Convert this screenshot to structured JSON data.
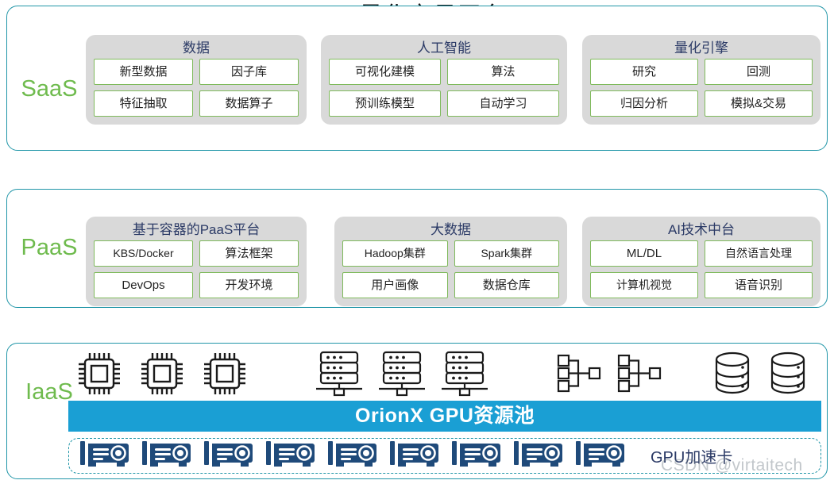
{
  "title": "AI 量化交易平台",
  "layers": [
    {
      "id": "saas",
      "label": "SaaS",
      "groups": [
        {
          "title": "数据",
          "cells": [
            "新型数据",
            "因子库",
            "特征抽取",
            "数据算子"
          ]
        },
        {
          "title": "人工智能",
          "cells": [
            "可视化建模",
            "算法",
            "预训练模型",
            "自动学习"
          ]
        },
        {
          "title": "量化引擎",
          "cells": [
            "研究",
            "回测",
            "归因分析",
            "模拟&交易"
          ]
        }
      ]
    },
    {
      "id": "paas",
      "label": "PaaS",
      "groups": [
        {
          "title": "基于容器的PaaS平台",
          "cells": [
            "KBS/Docker",
            "算法框架",
            "DevOps",
            "开发环境"
          ]
        },
        {
          "title": "大数据",
          "cells": [
            "Hadoop集群",
            "Spark集群",
            "用户画像",
            "数据仓库"
          ]
        },
        {
          "title": "AI技术中台",
          "cells": [
            "ML/DL",
            "自然语言处理",
            "计算机视觉",
            "语音识别"
          ]
        }
      ]
    },
    {
      "id": "iaas",
      "label": "IaaS",
      "icons": [
        {
          "name": "cpu-chip-icon",
          "count": 3
        },
        {
          "name": "server-rack-icon",
          "count": 3
        },
        {
          "name": "network-topology-icon",
          "count": 2
        },
        {
          "name": "database-cylinder-icon",
          "count": 2
        }
      ],
      "resource_pool_bar": "OrionX GPU资源池",
      "gpu_strip": {
        "card_icon": "gpu-accelerator-card-icon",
        "card_count": 9,
        "label": "GPU加速卡"
      }
    }
  ],
  "watermark": "CSDN @virtaitech",
  "colors": {
    "panel_border": "#2196a8",
    "layer_label": "#6fbb4e",
    "group_bg": "#d9d9d9",
    "group_title": "#2b3a66",
    "cell_border": "#7fba5c",
    "bar_blue": "#1a9fd4",
    "gpu_card": "#1f4a7a"
  }
}
